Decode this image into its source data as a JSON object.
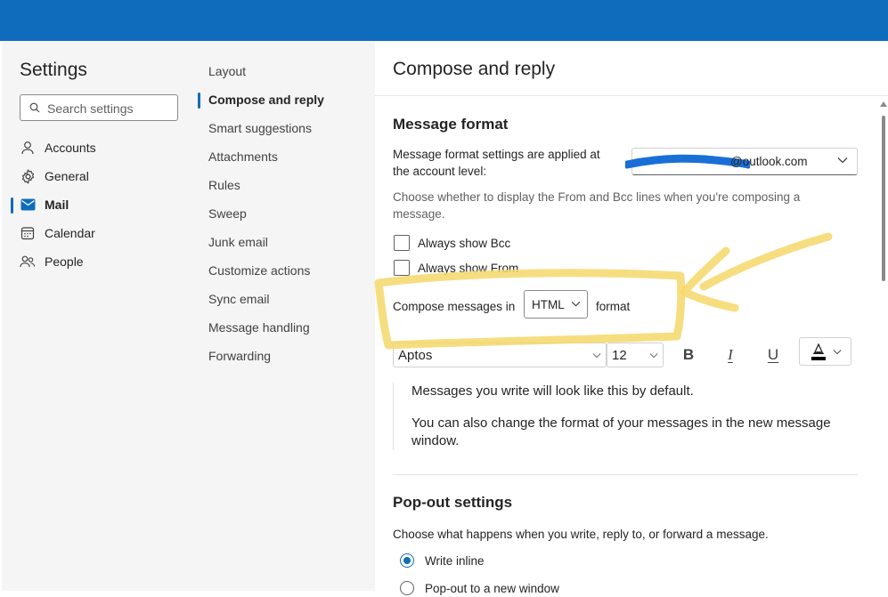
{
  "sidebar": {
    "title": "Settings",
    "search_placeholder": "Search settings",
    "items": [
      {
        "label": "Accounts",
        "icon": "person-icon"
      },
      {
        "label": "General",
        "icon": "gear-icon"
      },
      {
        "label": "Mail",
        "icon": "mail-icon",
        "active": true
      },
      {
        "label": "Calendar",
        "icon": "calendar-icon"
      },
      {
        "label": "People",
        "icon": "people-icon"
      }
    ]
  },
  "subnav": {
    "items": [
      {
        "label": "Layout"
      },
      {
        "label": "Compose and reply",
        "active": true
      },
      {
        "label": "Smart suggestions"
      },
      {
        "label": "Attachments"
      },
      {
        "label": "Rules"
      },
      {
        "label": "Sweep"
      },
      {
        "label": "Junk email"
      },
      {
        "label": "Customize actions"
      },
      {
        "label": "Sync email"
      },
      {
        "label": "Message handling"
      },
      {
        "label": "Forwarding"
      }
    ]
  },
  "pane": {
    "title": "Compose and reply",
    "message_format": {
      "heading": "Message format",
      "account_label_line1": "Message format settings are applied at",
      "account_label_line2": "the account level:",
      "account_value": "@outlook.com",
      "description_line1": "Choose whether to display the From and Bcc lines when you're composing a",
      "description_line2": "message.",
      "always_bcc": "Always show Bcc",
      "always_from": "Always show From",
      "compose_prefix": "Compose messages in",
      "compose_format": "HTML",
      "compose_suffix": "format",
      "font": "Aptos",
      "font_size": "12",
      "bold": "B",
      "italic": "I",
      "underline": "U",
      "preview_line1": "Messages you write will look like this by default.",
      "preview_line2a": "You can also change the format of your messages in the new message",
      "preview_line2b": "window."
    },
    "popout": {
      "heading": "Pop-out settings",
      "description": "Choose what happens when you write, reply to, or forward a message.",
      "option_inline": "Write inline",
      "option_window": "Pop-out to a new window"
    }
  },
  "colors": {
    "accent": "#0f6cbd",
    "highlight": "#f5d86a",
    "redaction": "#1a6fd6"
  }
}
